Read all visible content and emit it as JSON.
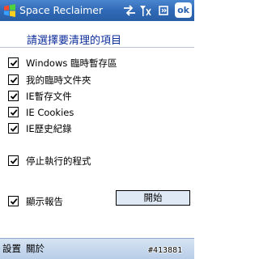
{
  "window": {
    "title": "Space Reclaimer",
    "ok_label": "ok"
  },
  "status_icons": [
    "sync-icon",
    "signal-icon",
    "volume-icon"
  ],
  "heading": "請選擇要清理的項目",
  "options": [
    {
      "label": "Windows 臨時暫存區",
      "checked": true
    },
    {
      "label": "我的臨時文件夾",
      "checked": true
    },
    {
      "label": "IE暫存文件",
      "checked": true
    },
    {
      "label": "IE Cookies",
      "checked": true
    },
    {
      "label": "IE歷史紀錄",
      "checked": true
    }
  ],
  "stop_programs": {
    "label": "停止執行的程式",
    "checked": true
  },
  "show_report": {
    "label": "顯示報告",
    "checked": true
  },
  "start_button": "開始",
  "menu": {
    "left": "設置",
    "right": "關於"
  },
  "watermark": "#413881",
  "colors": {
    "titlebar": "#2f68b4",
    "heading": "#0d2c9a",
    "menubar": "#c7d8ee"
  }
}
